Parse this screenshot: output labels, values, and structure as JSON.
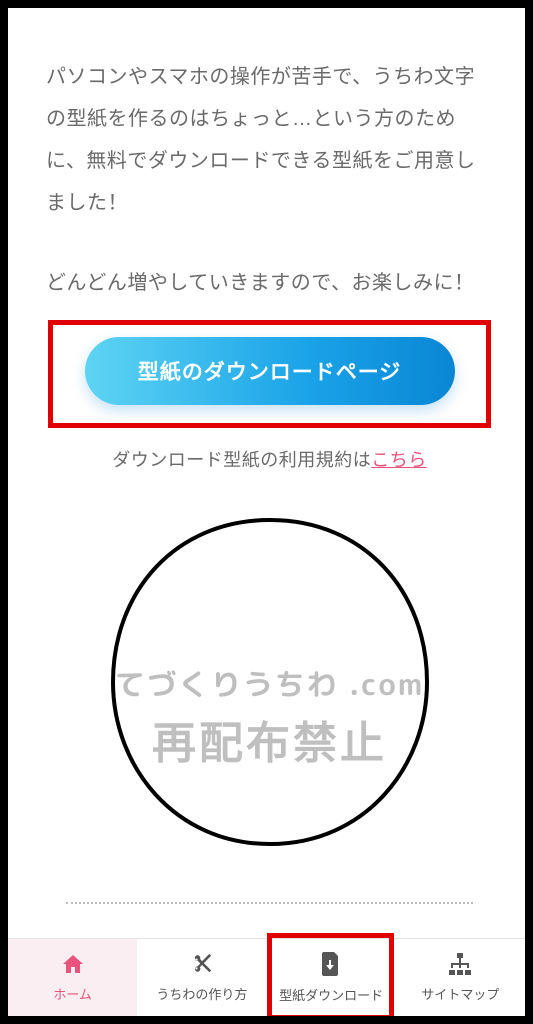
{
  "intro": {
    "paragraph1": "パソコンやスマホの操作が苦手で、うちわ文字の型紙を作るのはちょっと…という方のために、無料でダウンロードできる型紙をご用意しました！",
    "paragraph2": "どんどん増やしていきますので、お楽しみに！"
  },
  "cta": {
    "label": "型紙のダウンロードページ"
  },
  "terms": {
    "prefix": "ダウンロード型紙の利用規約は",
    "link_text": "こちら"
  },
  "watermark": {
    "line1": "てづくりうちわ .com",
    "line2": "再配布禁止"
  },
  "nav": {
    "items": [
      {
        "label": "ホーム",
        "icon": "home"
      },
      {
        "label": "うちわの作り方",
        "icon": "scissors"
      },
      {
        "label": "型紙ダウンロード",
        "icon": "file-download"
      },
      {
        "label": "サイトマップ",
        "icon": "sitemap"
      }
    ]
  }
}
